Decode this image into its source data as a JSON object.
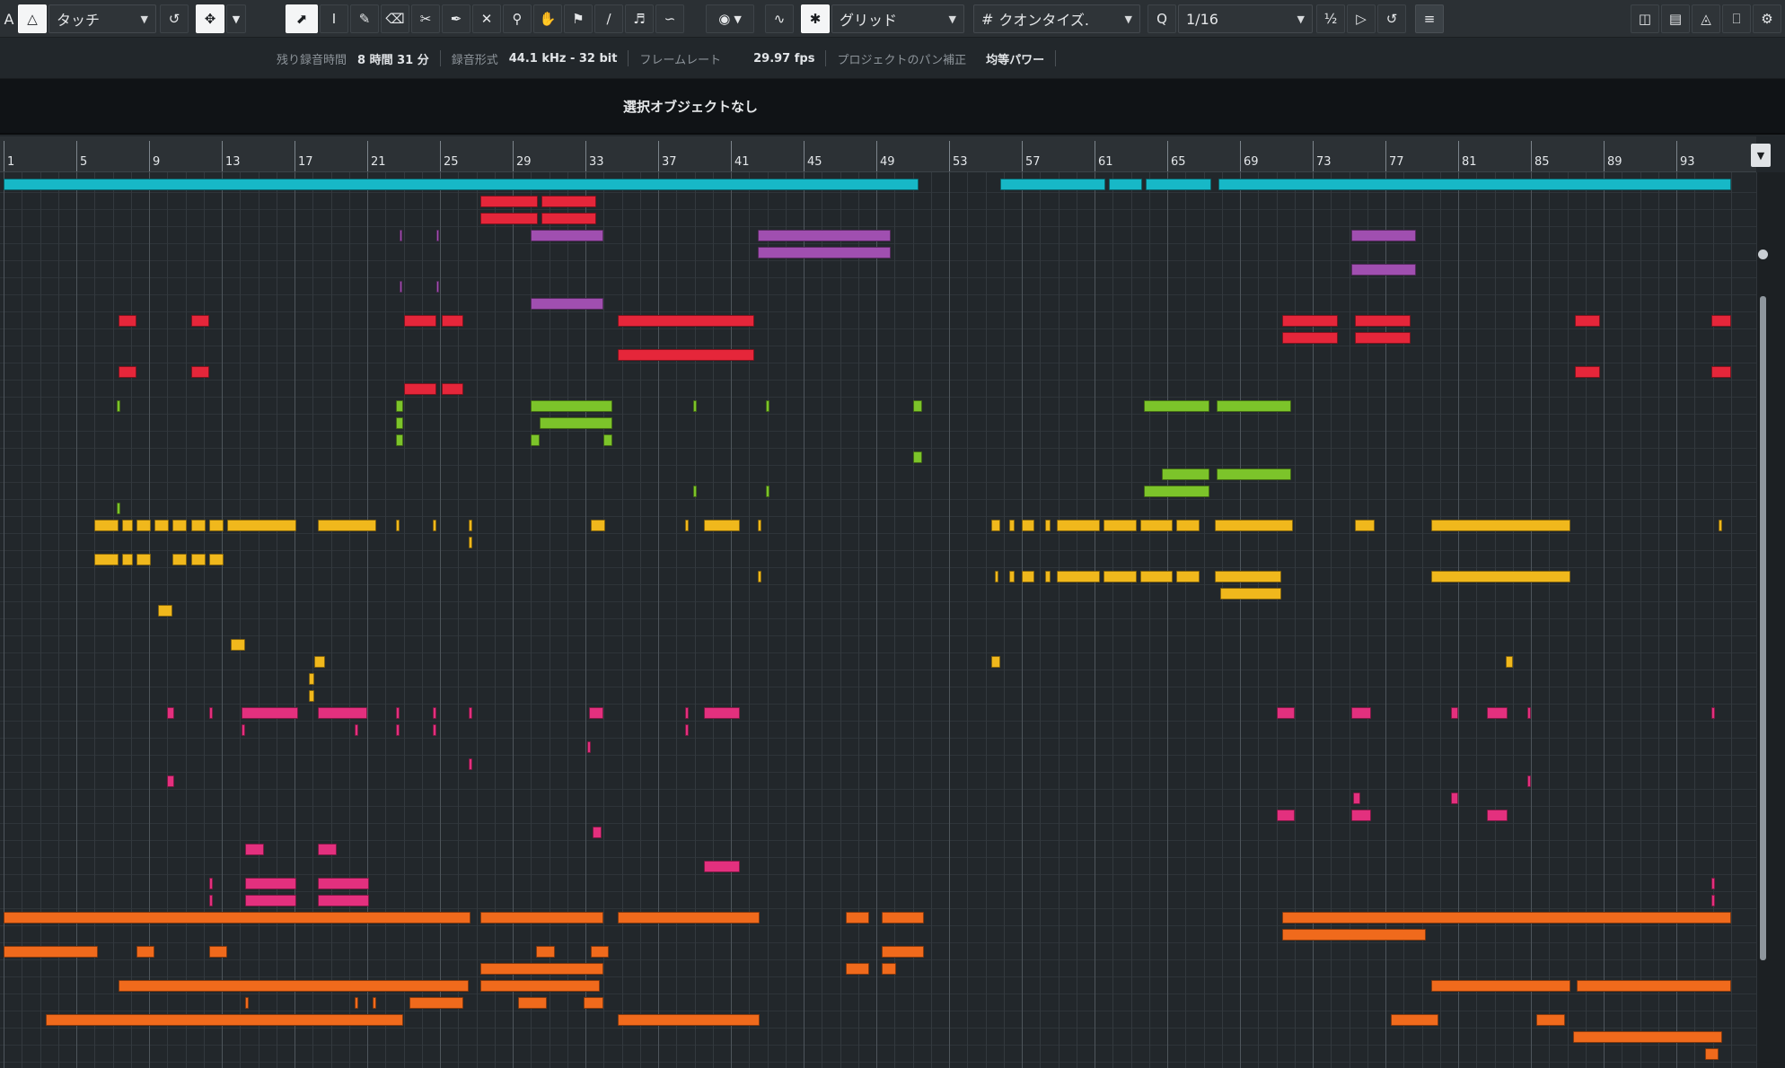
{
  "toolbar": {
    "lane_letter": "A",
    "automation_mode": "タッチ",
    "snap_mode": "グリッド",
    "quantize_label": "クオンタイズ.",
    "quantize_value": "1/16"
  },
  "info": {
    "rec_time_label": "残り録音時間",
    "rec_time_value": "8 時間 31 分",
    "rec_format_label": "録音形式",
    "rec_format_value": "44.1 kHz - 32 bit",
    "frame_rate_label": "フレームレート",
    "frame_rate_value": "29.97 fps",
    "pan_law_label": "プロジェクトのパン補正",
    "pan_law_value": "均等パワー"
  },
  "status": {
    "selection_text": "選択オブジェクトなし"
  },
  "ruler": {
    "labels": [
      "1",
      "5",
      "9",
      "13",
      "17",
      "21",
      "25",
      "29",
      "33",
      "37",
      "41",
      "45",
      "49",
      "53",
      "57",
      "61",
      "65",
      "69",
      "73",
      "77",
      "81",
      "85",
      "89",
      "93"
    ]
  },
  "colors": {
    "cyan": "#17b8c7",
    "red": "#e5263a",
    "purple": "#a04fb0",
    "green": "#7cc42a",
    "yellow": "#f0b81c",
    "pink": "#e3307e",
    "orange": "#f06a1c"
  },
  "icons": {
    "automation": "automation-icon",
    "arrow_tool": "arrow-icon",
    "range_tool": "range-icon",
    "pencil_tool": "pencil-icon",
    "erase_tool": "eraser-icon",
    "split_tool": "scissors-icon",
    "glue_tool": "glue-icon",
    "mute_tool": "mute-icon",
    "zoom_tool": "zoom-icon",
    "hand_tool": "hand-icon",
    "snap": "snap-icon",
    "gear": "gear-icon"
  }
}
